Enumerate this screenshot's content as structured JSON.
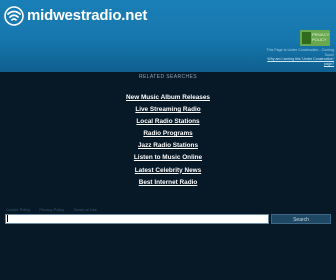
{
  "header": {
    "site_name": "midwestradio.net",
    "privacy_badge": {
      "line1": "PRIVACY",
      "line2": "POLICY"
    },
    "disclaimer": {
      "text": "This Page Is Under Construction - Coming Soon!",
      "link": "Why am I seeing this 'Under Construction' page?"
    }
  },
  "main": {
    "related_heading": "RELATED SEARCHES",
    "links": [
      "New Music Album Releases",
      "Live Streaming Radio",
      "Local Radio Stations",
      "Radio Programs",
      "Jazz Radio Stations",
      "Listen to Music Online",
      "Latest Celebrity News",
      "Best Internet Radio"
    ],
    "footer_links": [
      "Cookie Policy",
      "Privacy Policy",
      "Terms of Use"
    ],
    "search": {
      "value": "",
      "button_label": "Search"
    }
  },
  "colors": {
    "header_blue": "#1677ad",
    "page_background": "#071826",
    "badge_green": "#6aa84f"
  },
  "icons": {
    "logo": "wifi-signal-icon"
  }
}
